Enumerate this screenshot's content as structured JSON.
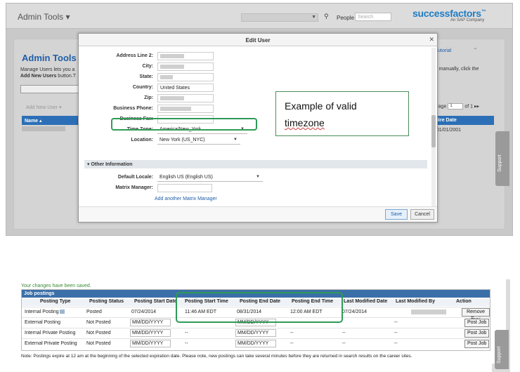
{
  "topbar": {
    "menu_label": "Admin Tools ▾",
    "people_label": "People",
    "people_placeholder": "Search",
    "logo_main": "successfactors",
    "logo_sub": "An SAP Company"
  },
  "background": {
    "title": "Admin Tools",
    "manage_text_1": "Manage Users lets you a",
    "manage_text_2_bold": "Add New Users",
    "manage_text_2_rest": " button.T",
    "tutorial_link": "r Tutorial",
    "right_text": "ers manually, click the",
    "add_new_user": "Add New User ▾",
    "name_col": "Name ▴",
    "page_label": "Page",
    "page_value": "1",
    "page_of": "of 1",
    "hire_date_col": "Hire Date",
    "hire_date_value": "01/01/2001",
    "support_tab": "Support"
  },
  "modal": {
    "title": "Edit User",
    "fields": [
      {
        "label": "Address Line 2:",
        "value": ""
      },
      {
        "label": "City:",
        "value": ""
      },
      {
        "label": "State:",
        "value": ""
      },
      {
        "label": "Country:",
        "value": "United States"
      },
      {
        "label": "Zip:",
        "value": ""
      },
      {
        "label": "Business Phone:",
        "value": ""
      },
      {
        "label": "Business Fax:",
        "value": ""
      }
    ],
    "time_zone": {
      "label": "Time Zone:",
      "value": "America/New_York"
    },
    "location": {
      "label": "Location:",
      "value": "New York (US_NYC)"
    },
    "section": "Other Information",
    "default_locale": {
      "label": "Default Locale:",
      "value": "English US (English US)"
    },
    "matrix_manager": {
      "label": "Matrix Manager:",
      "value": ""
    },
    "add_matrix_link": "Add another Matrix Manager",
    "save_label": "Save",
    "cancel_label": "Cancel"
  },
  "callout": {
    "line1": "Example of valid",
    "line2": "timezone"
  },
  "job_postings": {
    "saved_message": "Your changes have been saved.",
    "header": "Job postings",
    "columns": [
      "Posting Type",
      "Posting Status",
      "Posting Start Date",
      "Posting Start Time",
      "Posting End Date",
      "Posting End Time",
      "Last Modified Date",
      "Last Modified By",
      "Action"
    ],
    "rows": [
      {
        "type": "Internal Posting",
        "status": "Posted",
        "start_date": "07/24/2014",
        "start_time": "11:46 AM EDT",
        "end_date": "08/31/2014",
        "end_time": "12:00 AM EDT",
        "modified_date": "07/24/2014",
        "action": "Remove Post"
      },
      {
        "type": "External Posting",
        "status": "Not Posted",
        "start_date": "MM/DD/YYYY",
        "start_time": "",
        "end_date": "MM/DD/YYYY",
        "end_time": "",
        "modified_date": "",
        "modified_by": "--",
        "action": "Post Job"
      },
      {
        "type": "Internal Private Posting",
        "status": "Not Posted",
        "start_date": "MM/DD/YYYY",
        "start_time": "--",
        "end_date": "MM/DD/YYYY",
        "end_time": "--",
        "modified_date": "--",
        "modified_by": "--",
        "action": "Post Job"
      },
      {
        "type": "External Private Posting",
        "status": "Not Posted",
        "start_date": "MM/DD/YYYY",
        "start_time": "--",
        "end_date": "MM/DD/YYYY",
        "end_time": "--",
        "modified_date": "--",
        "modified_by": "--",
        "action": "Post Job"
      }
    ],
    "note": "Note: Postings expire at 12 am at the beginning of the selected expiration date. Please note, new postings can take several minutes before they are returned in search results on the career sites.",
    "support_tab": "Support"
  },
  "colors": {
    "accent": "#1f7cc3",
    "highlight": "#2e9b57",
    "grid_header": "#2c6fb6"
  }
}
